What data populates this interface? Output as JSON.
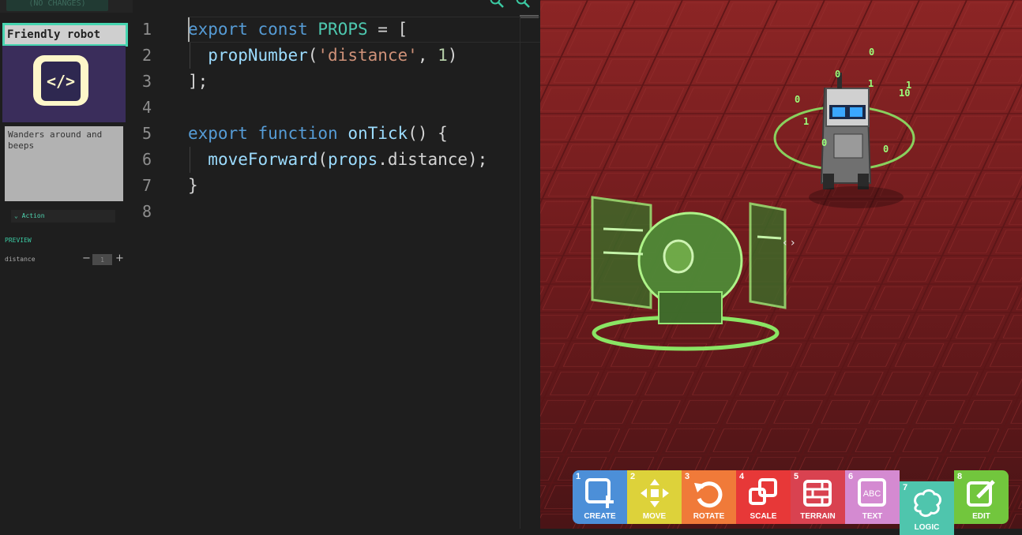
{
  "left_panel": {
    "changes_button": "(NO CHANGES)",
    "card_title": "Friendly robot",
    "card_icon": "code-brackets-icon",
    "card_icon_glyph": "</>",
    "card_description": "Wanders around and beeps",
    "action_dropdown": "Action",
    "preview_label": "PREVIEW",
    "prop_distance_label": "distance",
    "prop_distance_value": "1",
    "minus": "−",
    "plus": "+"
  },
  "editor": {
    "line_numbers": [
      "1",
      "2",
      "3",
      "4",
      "5",
      "6",
      "7",
      "8"
    ]
  },
  "viewport": {
    "cursor_hint": "‹ ›",
    "binary_digits": [
      "0",
      "0",
      "1",
      "1",
      "10",
      "0",
      "1",
      "0",
      "0"
    ]
  },
  "toolbar": {
    "tools": [
      {
        "num": "1",
        "label": "CREATE",
        "color": "#4c8fd8",
        "icon": "create-icon"
      },
      {
        "num": "2",
        "label": "MOVE",
        "color": "#ddd23a",
        "icon": "move-icon"
      },
      {
        "num": "3",
        "label": "ROTATE",
        "color": "#f07a39",
        "icon": "rotate-icon"
      },
      {
        "num": "4",
        "label": "SCALE",
        "color": "#e73838",
        "icon": "scale-icon"
      },
      {
        "num": "5",
        "label": "TERRAIN",
        "color": "#d94250",
        "icon": "terrain-icon"
      },
      {
        "num": "6",
        "label": "TEXT",
        "color": "#d48ad1",
        "icon": "text-icon"
      },
      {
        "num": "7",
        "label": "LOGIC",
        "color": "#4fc5ad",
        "icon": "brain-icon"
      },
      {
        "num": "8",
        "label": "EDIT",
        "color": "#72c63d",
        "icon": "edit-icon"
      }
    ]
  }
}
